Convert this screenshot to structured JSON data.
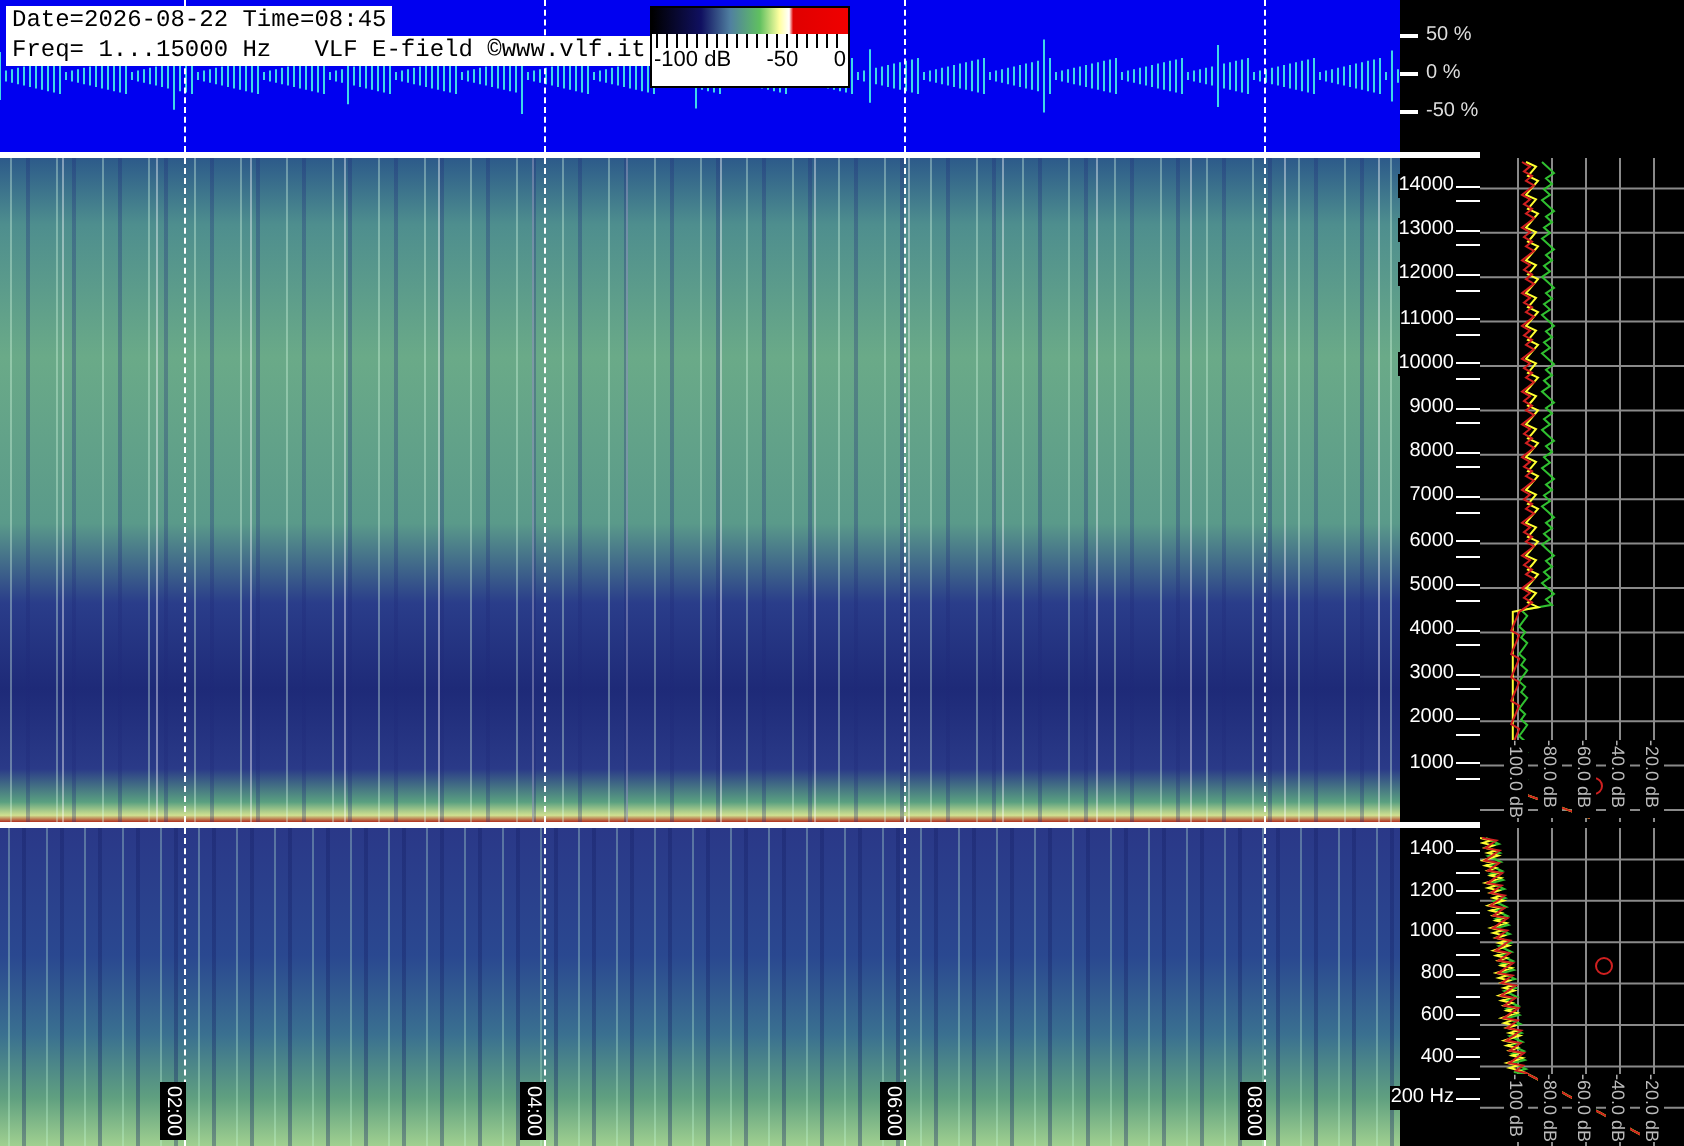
{
  "header": {
    "lines": [
      "Date=2026-08-22 Time=08:45",
      "Freq= 1...15000 Hz   VLF E-field ©www.vlf.it"
    ]
  },
  "colorbar": {
    "labels": [
      "-100 dB",
      "-50",
      "0"
    ]
  },
  "amplitude_axis": {
    "labels": [
      "50 %",
      "0 %",
      "-50 %"
    ]
  },
  "upper_panel": {
    "freq_labels": [
      "14000",
      "13000",
      "12000",
      "11000",
      "10000",
      "9000",
      "8000",
      "7000",
      "6000",
      "5000",
      "4000",
      "3000",
      "2000",
      "1000"
    ],
    "db_labels": [
      "-100.0 dB",
      "-80.0 dB",
      "-60.0 dB",
      "-40.0 dB",
      "-20.0 dB"
    ]
  },
  "lower_panel": {
    "freq_labels": [
      "1400",
      "1200",
      "1000",
      "800",
      "600",
      "400",
      "200 Hz"
    ],
    "db_labels": [
      "-100 dB",
      "-80.0 dB",
      "-60.0 dB",
      "-40.0 dB",
      "-20.0 dB"
    ]
  },
  "time_labels": [
    "02:00",
    "04:00",
    "06:00",
    "08:00"
  ]
}
